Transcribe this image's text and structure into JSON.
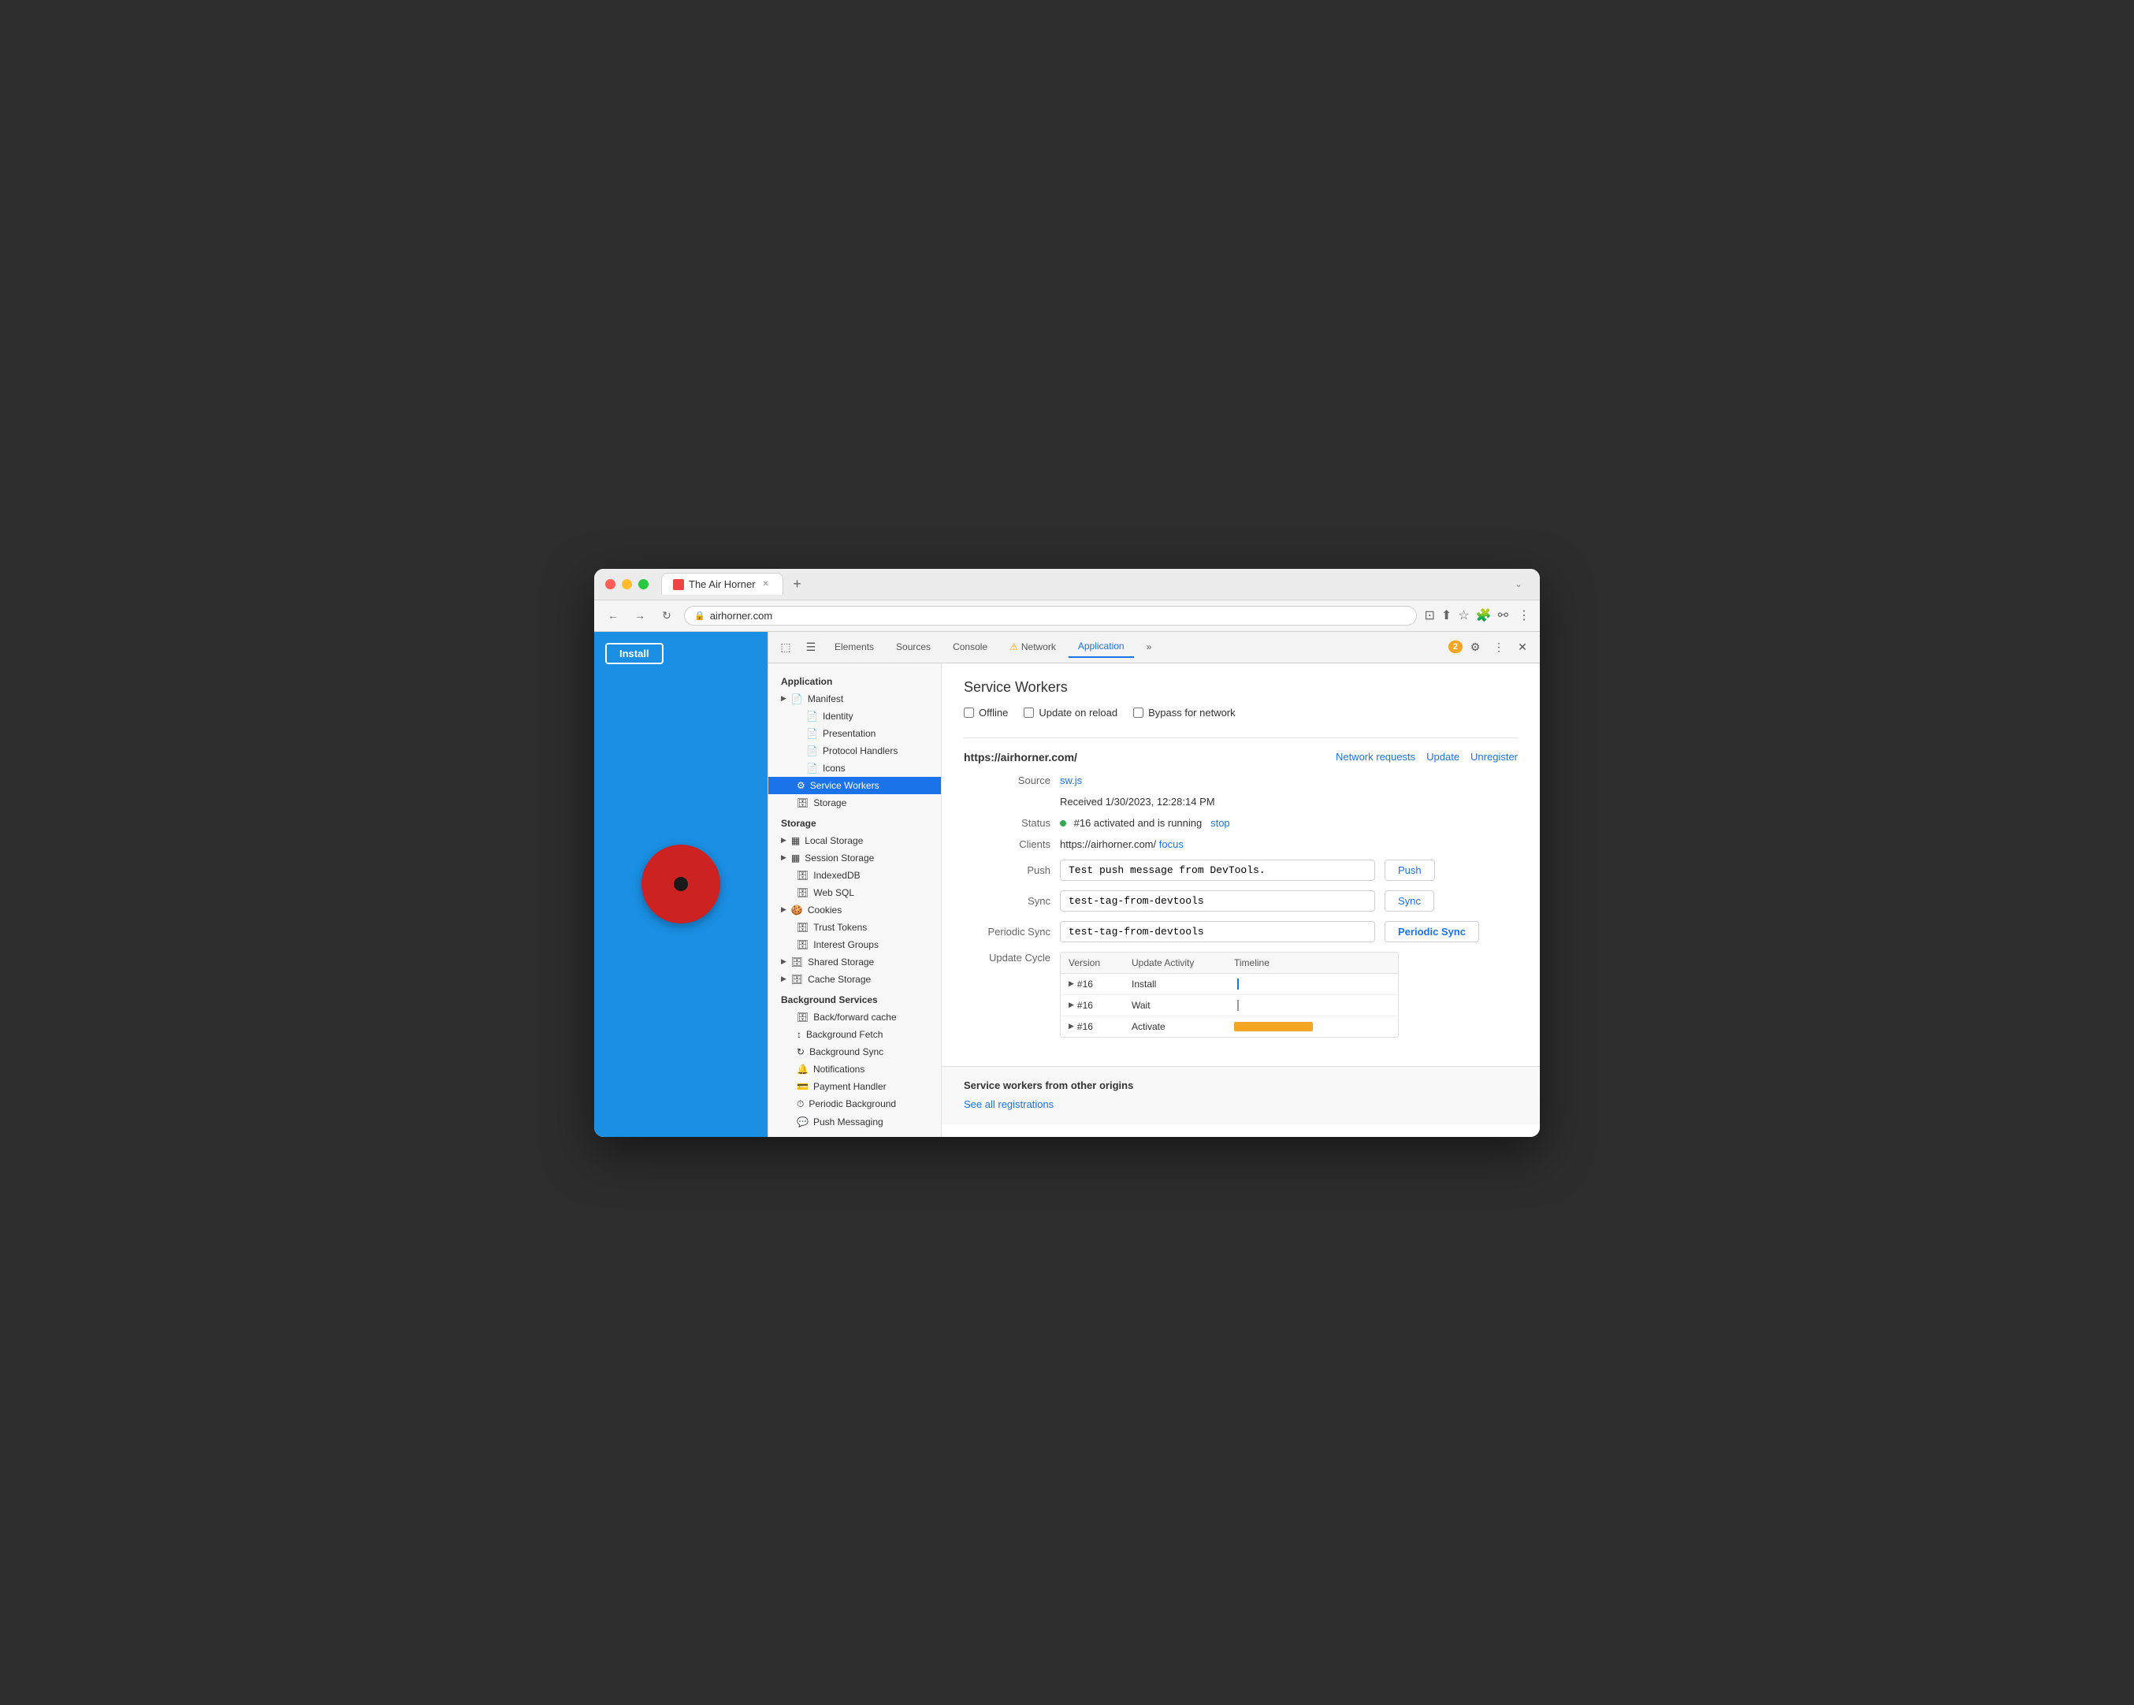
{
  "window": {
    "title": "The Air Horner",
    "url": "airhorner.com"
  },
  "browser_tabs": [
    {
      "label": "The Air Horner",
      "active": true
    }
  ],
  "devtools": {
    "tabs": [
      {
        "label": "Elements",
        "active": false
      },
      {
        "label": "Sources",
        "active": false
      },
      {
        "label": "Console",
        "active": false
      },
      {
        "label": "Network",
        "active": false,
        "warning": true
      },
      {
        "label": "Application",
        "active": true
      }
    ],
    "more_tabs": "»",
    "warning_count": "2",
    "sidebar": {
      "sections": [
        {
          "title": "Application",
          "items": [
            {
              "label": "Manifest",
              "icon": "▶",
              "indent": 1,
              "expandable": true
            },
            {
              "label": "Identity",
              "icon": "📄",
              "indent": 2
            },
            {
              "label": "Presentation",
              "icon": "📄",
              "indent": 2
            },
            {
              "label": "Protocol Handlers",
              "icon": "📄",
              "indent": 2
            },
            {
              "label": "Icons",
              "icon": "📄",
              "indent": 2
            },
            {
              "label": "Service Workers",
              "icon": "⚙",
              "indent": 1,
              "active": true
            },
            {
              "label": "Storage",
              "icon": "🗄",
              "indent": 1
            }
          ]
        },
        {
          "title": "Storage",
          "items": [
            {
              "label": "Local Storage",
              "icon": "▶",
              "indent": 1,
              "expandable": true
            },
            {
              "label": "Session Storage",
              "icon": "▶",
              "indent": 1,
              "expandable": true
            },
            {
              "label": "IndexedDB",
              "icon": "🗄",
              "indent": 1
            },
            {
              "label": "Web SQL",
              "icon": "🗄",
              "indent": 1
            },
            {
              "label": "Cookies",
              "icon": "▶",
              "indent": 1,
              "expandable": true
            },
            {
              "label": "Trust Tokens",
              "icon": "🗄",
              "indent": 1
            },
            {
              "label": "Interest Groups",
              "icon": "🗄",
              "indent": 1
            },
            {
              "label": "Shared Storage",
              "icon": "▶",
              "indent": 1,
              "expandable": true
            },
            {
              "label": "Cache Storage",
              "icon": "▶",
              "indent": 1,
              "expandable": true
            }
          ]
        },
        {
          "title": "Background Services",
          "items": [
            {
              "label": "Back/forward cache",
              "icon": "🗄",
              "indent": 1
            },
            {
              "label": "Background Fetch",
              "icon": "↕",
              "indent": 1
            },
            {
              "label": "Background Sync",
              "icon": "↻",
              "indent": 1
            },
            {
              "label": "Notifications",
              "icon": "🔔",
              "indent": 1
            },
            {
              "label": "Payment Handler",
              "icon": "💳",
              "indent": 1
            },
            {
              "label": "Periodic Background",
              "icon": "⏱",
              "indent": 1
            },
            {
              "label": "Push Messaging",
              "icon": "💬",
              "indent": 1
            }
          ]
        }
      ]
    },
    "service_workers": {
      "title": "Service Workers",
      "checkboxes": [
        {
          "label": "Offline",
          "checked": false
        },
        {
          "label": "Update on reload",
          "checked": false
        },
        {
          "label": "Bypass for network",
          "checked": false
        }
      ],
      "origin": {
        "url": "https://airhorner.com/",
        "links": [
          {
            "label": "Network requests"
          },
          {
            "label": "Update"
          },
          {
            "label": "Unregister"
          }
        ]
      },
      "fields": {
        "source_label": "Source",
        "source_link": "sw.js",
        "received_label": "",
        "received_value": "Received 1/30/2023, 12:28:14 PM",
        "status_label": "Status",
        "status_text": "#16 activated and is running",
        "status_link": "stop",
        "clients_label": "Clients",
        "clients_url": "https://airhorner.com/",
        "clients_link": "focus",
        "push_label": "Push",
        "push_value": "Test push message from DevTools.",
        "push_btn": "Push",
        "sync_label": "Sync",
        "sync_value": "test-tag-from-devtools",
        "sync_btn": "Sync",
        "periodic_sync_label": "Periodic Sync",
        "periodic_sync_value": "test-tag-from-devtools",
        "periodic_sync_btn": "Periodic Sync",
        "update_cycle_label": "Update Cycle"
      },
      "update_cycle": {
        "headers": [
          "Version",
          "Update Activity",
          "Timeline"
        ],
        "rows": [
          {
            "version": "#16",
            "activity": "Install",
            "timeline_type": "line_blue"
          },
          {
            "version": "#16",
            "activity": "Wait",
            "timeline_type": "line_gray"
          },
          {
            "version": "#16",
            "activity": "Activate",
            "timeline_type": "bar_orange"
          }
        ]
      },
      "other_origins": {
        "title": "Service workers from other origins",
        "link": "See all registrations"
      }
    }
  }
}
